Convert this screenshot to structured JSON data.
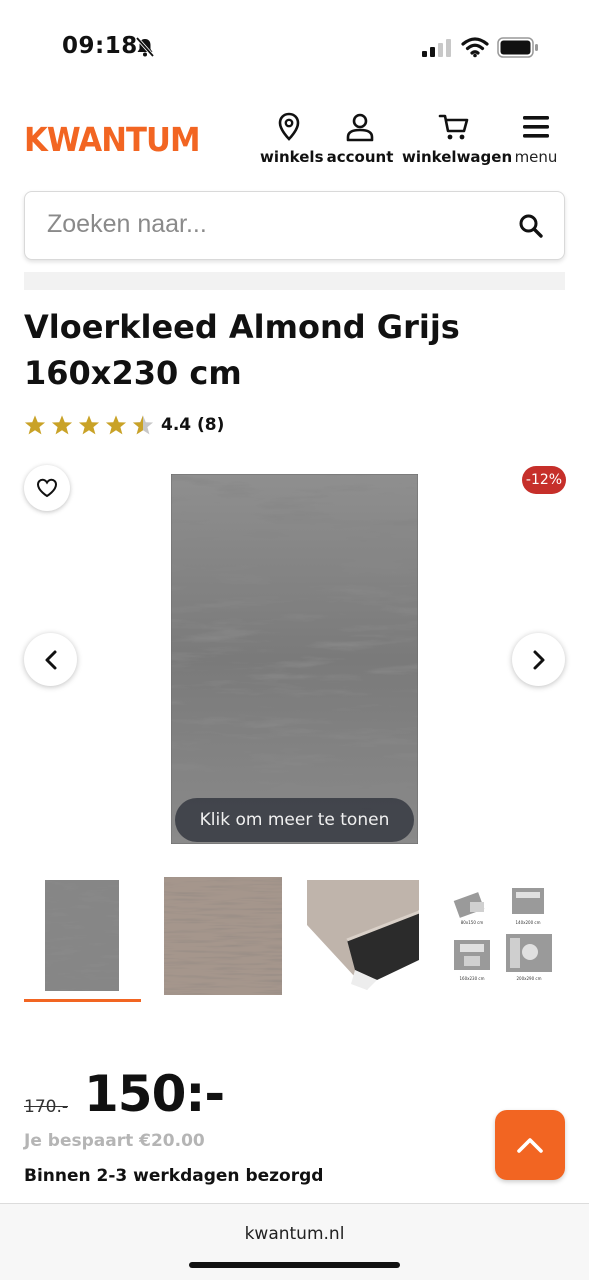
{
  "status_bar": {
    "time": "09:18"
  },
  "header": {
    "logo": "KWANTUM",
    "nav": [
      {
        "label": "winkels",
        "icon": "location-pin-icon"
      },
      {
        "label": "account",
        "icon": "user-icon"
      },
      {
        "label": "winkelwagen",
        "icon": "cart-icon"
      },
      {
        "label": "menu",
        "icon": "hamburger-icon"
      }
    ],
    "brand_color": "#f26522"
  },
  "search": {
    "placeholder": "Zoeken naar..."
  },
  "product": {
    "title": "Vloerkleed Almond Grijs 160x230 cm",
    "rating": {
      "value": 4.4,
      "text": "4.4 (8)",
      "stars": 5,
      "star_color": "#c9a227"
    },
    "discount_badge": "-12%",
    "more_label": "Klik om meer te tonen",
    "thumbnail_count": 4,
    "thumb_size_labels": [
      "80x150 cm",
      "140x200 cm",
      "160x230 cm",
      "200x290 cm"
    ]
  },
  "price": {
    "old": "170.-",
    "current": "150:-",
    "savings": "Je bespaart €20.00",
    "delivery": "Binnen 2-3 werkdagen bezorgd"
  },
  "browser": {
    "url": "kwantum.nl"
  }
}
